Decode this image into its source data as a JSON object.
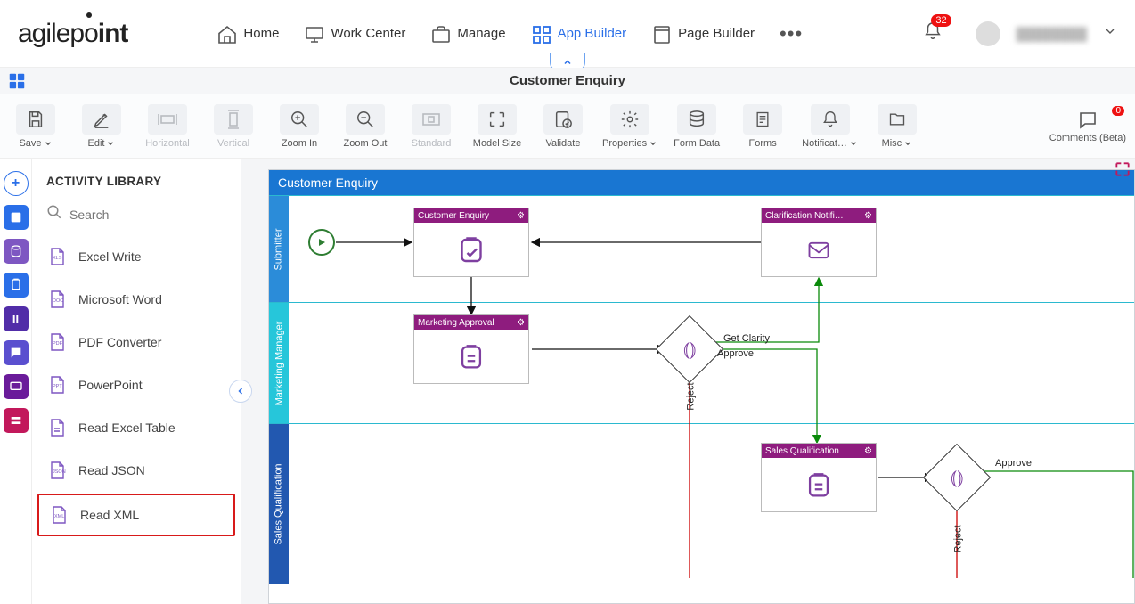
{
  "brand": {
    "pre": "agilep",
    "dot_char": "o",
    "post": "int"
  },
  "nav": {
    "home": "Home",
    "work_center": "Work Center",
    "manage": "Manage",
    "app_builder": "App Builder",
    "page_builder": "Page Builder"
  },
  "notifications": {
    "count": "32"
  },
  "user": {
    "name": "████████"
  },
  "page_title": "Customer Enquiry",
  "toolbar": {
    "save": "Save",
    "edit": "Edit",
    "horizontal": "Horizontal",
    "vertical": "Vertical",
    "zoom_in": "Zoom In",
    "zoom_out": "Zoom Out",
    "standard": "Standard",
    "model_size": "Model Size",
    "validate": "Validate",
    "properties": "Properties",
    "form_data": "Form Data",
    "forms": "Forms",
    "notifications": "Notificat…",
    "misc": "Misc",
    "comments": "Comments (Beta)",
    "comments_count": "0"
  },
  "library": {
    "title": "ACTIVITY LIBRARY",
    "search_placeholder": "Search",
    "items": [
      {
        "label": "Excel Write",
        "icon": "XLS"
      },
      {
        "label": "Microsoft Word",
        "icon": "DOC"
      },
      {
        "label": "PDF Converter",
        "icon": "PDF"
      },
      {
        "label": "PowerPoint",
        "icon": "PPT"
      },
      {
        "label": "Read Excel Table",
        "icon": ""
      },
      {
        "label": "Read JSON",
        "icon": "JSON"
      },
      {
        "label": "Read XML",
        "icon": "XML"
      }
    ],
    "highlight_index": 6
  },
  "canvas": {
    "title": "Customer Enquiry",
    "lanes": [
      {
        "label": "Submitter"
      },
      {
        "label": "Marketing Manager"
      },
      {
        "label": "Sales Qualification"
      }
    ],
    "nodes": {
      "customer_enquiry": "Customer Enquiry",
      "clarification_notify": "Clarification Notifi…",
      "marketing_approval": "Marketing Approval",
      "sales_qualification": "Sales Qualification"
    },
    "edge_labels": {
      "get_clarity": "Get Clarity",
      "approve1": "Approve",
      "reject1": "Reject",
      "approve2": "Approve",
      "reject2": "Reject"
    }
  }
}
